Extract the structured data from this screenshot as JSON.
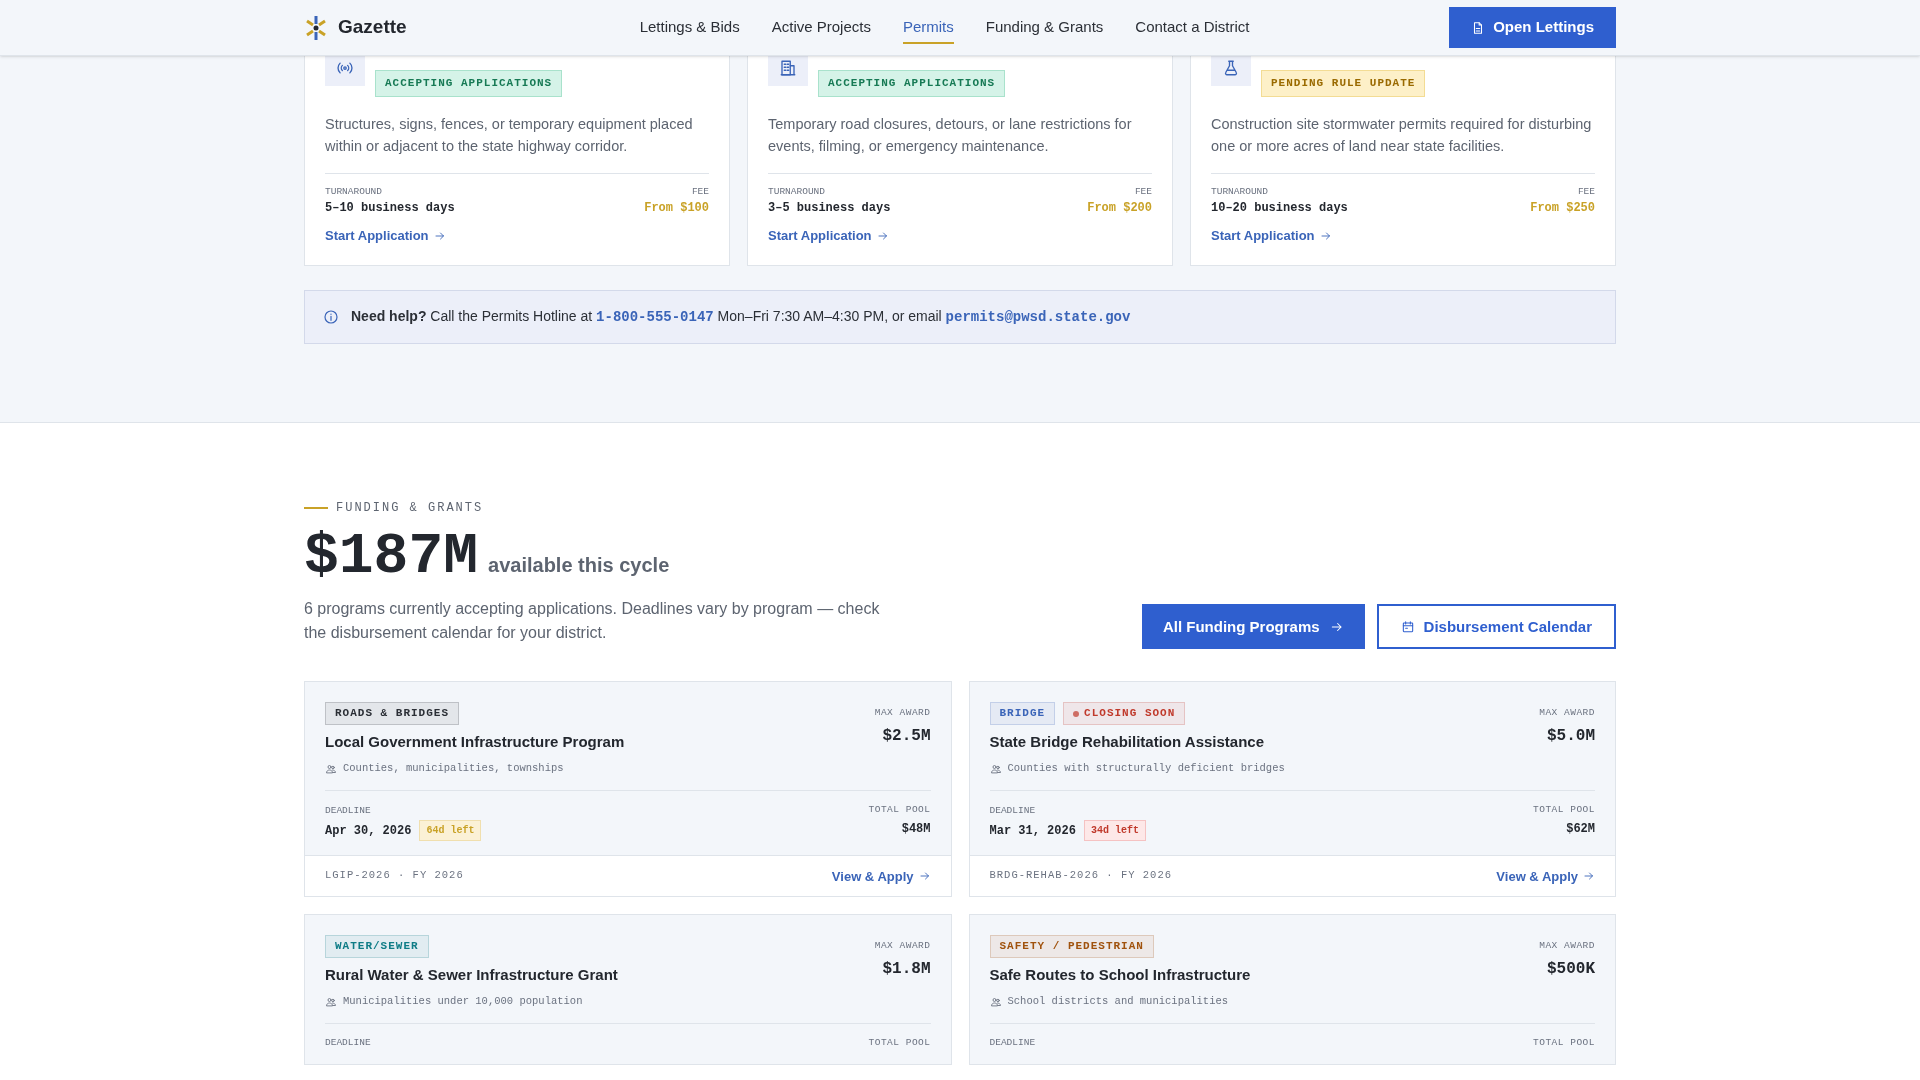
{
  "header": {
    "brand": "Gazette",
    "nav": [
      {
        "label": "Lettings & Bids",
        "selected": false
      },
      {
        "label": "Active Projects",
        "selected": false
      },
      {
        "label": "Permits",
        "selected": true
      },
      {
        "label": "Funding & Grants",
        "selected": false
      },
      {
        "label": "Contact a District",
        "selected": false
      }
    ],
    "cta": "Open Lettings"
  },
  "permits": [
    {
      "status": {
        "label": "ACCEPTING APPLICATIONS",
        "kind": "accepting"
      },
      "description": "Structures, signs, fences, or temporary equipment placed within or adjacent to the state highway corridor.",
      "turnaround_label": "TURNAROUND",
      "turnaround": "5–10 business days",
      "fee_label": "FEE",
      "fee": "From $100",
      "link": "Start Application"
    },
    {
      "status": {
        "label": "ACCEPTING APPLICATIONS",
        "kind": "accepting"
      },
      "description": "Temporary road closures, detours, or lane restrictions for events, filming, or emergency maintenance.",
      "turnaround_label": "TURNAROUND",
      "turnaround": "3–5 business days",
      "fee_label": "FEE",
      "fee": "From $200",
      "link": "Start Application"
    },
    {
      "status": {
        "label": "PENDING RULE UPDATE",
        "kind": "pending"
      },
      "description": "Construction site stormwater permits required for disturbing one or more acres of land near state facilities.",
      "turnaround_label": "TURNAROUND",
      "turnaround": "10–20 business days",
      "fee_label": "FEE",
      "fee": "From $250",
      "link": "Start Application"
    }
  ],
  "help": {
    "lead": "Need help?",
    "before": "Call the Permits Hotline at",
    "phone": "1-800-555-0147",
    "middle": "Mon–Fri 7:30 AM–4:30 PM, or email",
    "email": "permits@pwsd.state.gov"
  },
  "funding": {
    "eyebrow": "FUNDING & GRANTS",
    "amount": "$187M",
    "amount_caption": "available this cycle",
    "description": "6 programs currently accepting applications. Deadlines vary by program — check the disbursement calendar for your district.",
    "primary_button": "All Funding Programs",
    "secondary_button": "Disbursement Calendar",
    "programs": [
      {
        "tags": [
          {
            "label": "ROADS & BRIDGES",
            "color": "#2b2f36",
            "dot": false
          }
        ],
        "title": "Local Government Infrastructure Program",
        "eligibility": "Counties, municipalities, townships",
        "max_award_label": "MAX AWARD",
        "max_award": "$2.5M",
        "deadline_label": "DEADLINE",
        "deadline": "Apr 30, 2026",
        "days_left": {
          "label": "64d left",
          "kind": "warn"
        },
        "pool_label": "TOTAL POOL",
        "pool": "$48M",
        "code": "LGIP-2026 · FY 2026",
        "link": "View & Apply"
      },
      {
        "tags": [
          {
            "label": "BRIDGE",
            "color": "#3a64b8",
            "dot": false
          },
          {
            "label": "CLOSING SOON",
            "color": "#c0392b",
            "dot": true
          }
        ],
        "title": "State Bridge Rehabilitation Assistance",
        "eligibility": "Counties with structurally deficient bridges",
        "max_award_label": "MAX AWARD",
        "max_award": "$5.0M",
        "deadline_label": "DEADLINE",
        "deadline": "Mar 31, 2026",
        "days_left": {
          "label": "34d left",
          "kind": "urgent"
        },
        "pool_label": "TOTAL POOL",
        "pool": "$62M",
        "code": "BRDG-REHAB-2026 · FY 2026",
        "link": "View & Apply"
      },
      {
        "tags": [
          {
            "label": "WATER/SEWER",
            "color": "#0e7c86",
            "dot": false
          }
        ],
        "title": "Rural Water & Sewer Infrastructure Grant",
        "eligibility": "Municipalities under 10,000 population",
        "max_award_label": "MAX AWARD",
        "max_award": "$1.8M",
        "deadline_label": "DEADLINE",
        "pool_label": "TOTAL POOL"
      },
      {
        "tags": [
          {
            "label": "SAFETY / PEDESTRIAN",
            "color": "#a0520d",
            "dot": false
          }
        ],
        "title": "Safe Routes to School Infrastructure",
        "eligibility": "School districts and municipalities",
        "max_award_label": "MAX AWARD",
        "max_award": "$500K",
        "deadline_label": "DEADLINE",
        "pool_label": "TOTAL POOL"
      }
    ]
  }
}
